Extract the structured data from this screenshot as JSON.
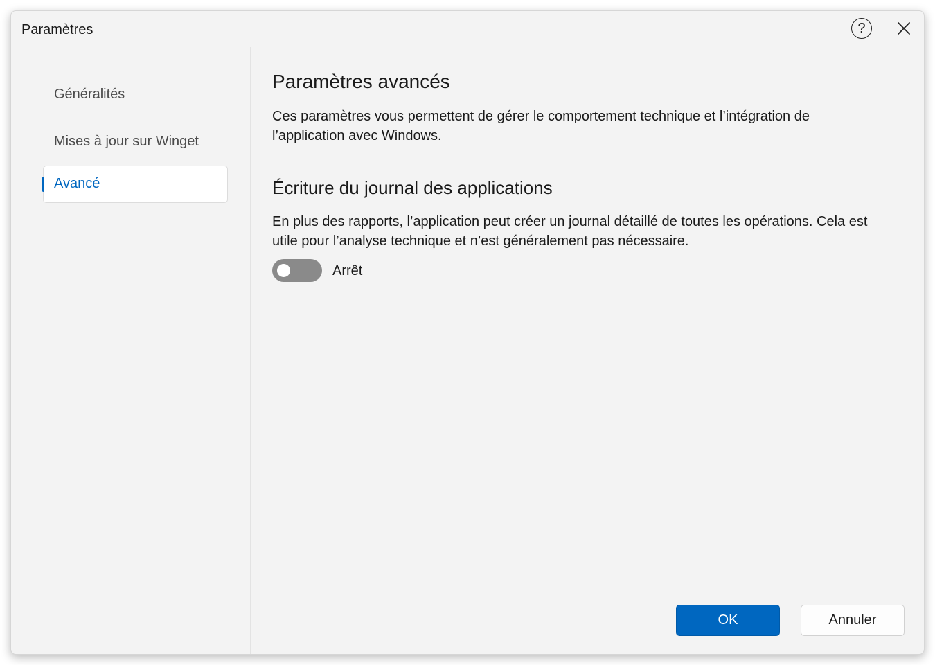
{
  "window": {
    "title": "Paramètres"
  },
  "titlebar": {
    "help_glyph": "?",
    "help_icon": "help-circle-icon",
    "close_icon": "close-icon"
  },
  "sidebar": {
    "items": [
      {
        "label": "Généralités",
        "active": false
      },
      {
        "label": "Mises à jour sur Winget",
        "active": false
      },
      {
        "label": "Avancé",
        "active": true
      }
    ]
  },
  "main": {
    "heading": "Paramètres avancés",
    "description": "Ces paramètres vous permettent de gérer le comportement technique et l’intégration de l’application avec Windows.",
    "section": {
      "heading": "Écriture du journal des applications",
      "description": "En plus des rapports, l’application peut créer un journal détaillé de toutes les opérations. Cela est utile pour l’analyse technique et n’est généralement pas nécessaire.",
      "toggle_state": false,
      "toggle_label": "Arrêt"
    }
  },
  "footer": {
    "ok_label": "OK",
    "cancel_label": "Annuler"
  },
  "colors": {
    "accent": "#0067c0",
    "window_bg": "#f3f3f3",
    "toggle_off": "#8a8a8a"
  }
}
